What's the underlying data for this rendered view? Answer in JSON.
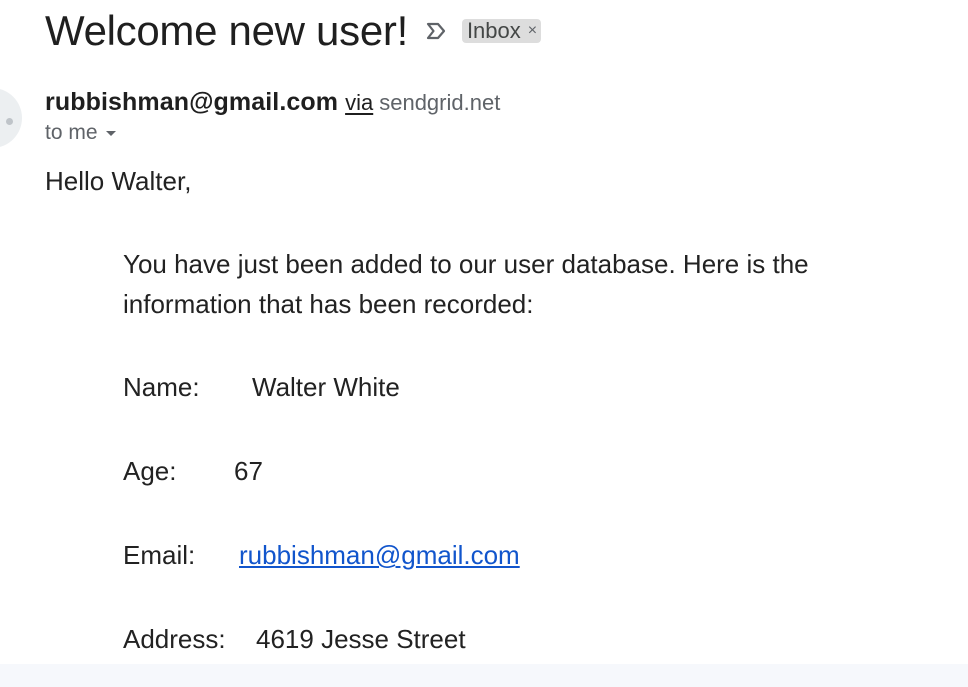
{
  "email": {
    "subject": "Welcome new user!",
    "label": "Inbox",
    "label_close": "×",
    "sender": {
      "email": "rubbishman@gmail.com",
      "via_word": "via",
      "via_domain": "sendgrid.net"
    },
    "recipient": "to me",
    "body": {
      "greeting": "Hello Walter,",
      "intro": "You have just been added to our user database. Here is the information that has been recorded:",
      "fields": {
        "name": {
          "label": "Name:",
          "value": "Walter White"
        },
        "age": {
          "label": "Age:",
          "value": "67"
        },
        "email": {
          "label": "Email:",
          "value": "rubbishman@gmail.com"
        },
        "address": {
          "label": "Address:",
          "value": "4619 Jesse Street"
        }
      }
    }
  },
  "icons": {
    "important": "label-important-icon",
    "recipient_dropdown": "caret-down-icon",
    "avatar": "sender-avatar"
  },
  "colors": {
    "link": "#1155cc",
    "label_chip_bg": "#dddddd",
    "secondary_text": "#5f6368",
    "bottom_strip": "#f6f8fc"
  }
}
